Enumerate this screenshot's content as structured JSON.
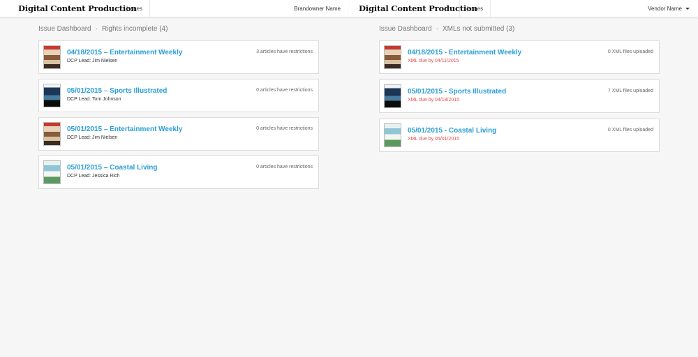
{
  "brandowner_bar": {
    "app_title": "Digital Content Production",
    "issues_tab": "Issues",
    "user_name": "Brandowner Name"
  },
  "vendor_bar": {
    "app_title": "Digital Content Production",
    "issues_tab": "Issues",
    "user_name": "Vendor Name"
  },
  "left_panel": {
    "breadcrumb_root": "Issue Dashboard",
    "separator": "·",
    "breadcrumb_current": "Rights incomplete (4)",
    "issues": [
      {
        "title": "04/18/2015 – Entertainment Weekly",
        "subtitle": "DCP Lead: Jim Nielsen",
        "status": "3 articles have restrictions",
        "cover": "entertainment-weekly-cover"
      },
      {
        "title": "05/01/2015 – Sports Illustrated",
        "subtitle": "DCP Lead: Tom Johnson",
        "status": "0 articles have restrictions",
        "cover": "sports-illustrated-cover"
      },
      {
        "title": "05/01/2015 – Entertainment Weekly",
        "subtitle": "DCP Lead: Jim Nielsen",
        "status": "0 articles have restrictions",
        "cover": "entertainment-weekly-cover"
      },
      {
        "title": "05/01/2015 – Coastal Living",
        "subtitle": "DCP Lead: Jessica Rich",
        "status": "0 articles have restrictions",
        "cover": "coastal-living-cover"
      }
    ]
  },
  "right_panel": {
    "breadcrumb_root": "Issue Dashboard",
    "separator": "·",
    "breadcrumb_current": "XMLs not submitted (3)",
    "issues": [
      {
        "title": "04/18/2015 - Entertainment Weekly",
        "subtitle": "XML due by 04/11/2015",
        "status": "0 XML files uploaded",
        "cover": "entertainment-weekly-cover"
      },
      {
        "title": "05/01/2015 - Sports Illustrated",
        "subtitle": "XML due by 04/18/2015",
        "status": "7 XML files uploaded",
        "cover": "sports-illustrated-cover"
      },
      {
        "title": "05/01/2015 - Coastal Living",
        "subtitle": "XML due by 05/01/2015",
        "status": "0 XML files uploaded",
        "cover": "coastal-living-cover"
      }
    ]
  },
  "colors": {
    "link": "#2a9fd6",
    "due_text": "#e05050",
    "background": "#f6f6f6"
  }
}
